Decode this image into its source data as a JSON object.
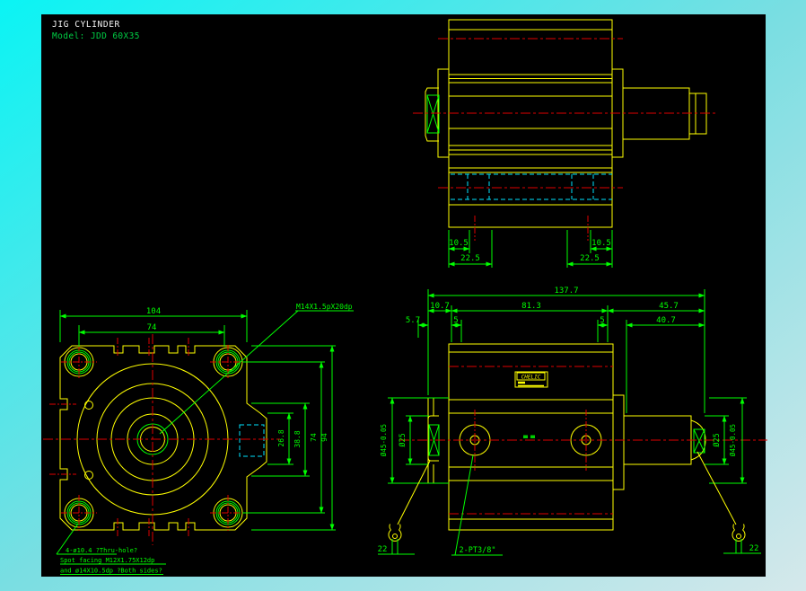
{
  "window": {
    "bg_gradient_start": "#0AF4F4",
    "bg_gradient_end": "#D5E8EB",
    "canvas_color": "#000000"
  },
  "palette": {
    "outline_yellow": "#FFFF00",
    "dimension_green": "#00FF00",
    "centerline_red": "#DE0000",
    "hidden_cyan": "#00E5FF",
    "title_white": "#F2F2F2",
    "model_green": "#00CC44"
  },
  "title_block": {
    "title": "JIG CYLINDER",
    "model": "Model: JDD 60X35"
  },
  "top_view": {
    "dim_left_inner": "10.5",
    "dim_left_outer": "22.5",
    "dim_right_inner": "10.5",
    "dim_right_outer": "22.5"
  },
  "side_view": {
    "dim_overall": "137.7",
    "dim_left_offset": "10.7",
    "dim_body": "81.3",
    "dim_rod_side": "45.7",
    "dim_flange_thk": "5.7",
    "dim_step_left": "5",
    "dim_step_right": "5",
    "dim_rod_len": "40.7",
    "dia_left_outer": "Ø45-0.05",
    "dia_left_inner": "Ø25",
    "dia_right_inner": "Ø25",
    "dia_right_outer": "Ø45-0.05",
    "dim_wrench_left": "22",
    "dim_wrench_right": "22",
    "port_callout": "2-PT3/8\"",
    "nameplate": "CHELIC"
  },
  "front_view": {
    "dim_width_overall": "104",
    "dim_width_inner": "74",
    "dim_port_inner": "26.8",
    "dim_port_outer": "38.8",
    "dim_height_inner": "74",
    "dim_height_overall": "94",
    "thread_callout": "M14X1.5pX20dp",
    "notes": [
      "4-ø10.4 ?Thru-hole?",
      "Spot facing  M12X1.75X12dp",
      "and ø14X10.5dp ?Both sides?"
    ]
  }
}
